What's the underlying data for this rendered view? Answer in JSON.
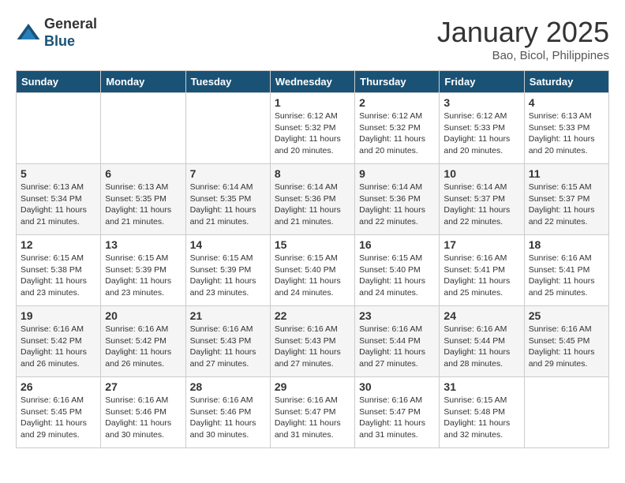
{
  "logo": {
    "general": "General",
    "blue": "Blue"
  },
  "title": "January 2025",
  "subtitle": "Bao, Bicol, Philippines",
  "days_of_week": [
    "Sunday",
    "Monday",
    "Tuesday",
    "Wednesday",
    "Thursday",
    "Friday",
    "Saturday"
  ],
  "weeks": [
    [
      {
        "day": "",
        "sunrise": "",
        "sunset": "",
        "daylight": ""
      },
      {
        "day": "",
        "sunrise": "",
        "sunset": "",
        "daylight": ""
      },
      {
        "day": "",
        "sunrise": "",
        "sunset": "",
        "daylight": ""
      },
      {
        "day": "1",
        "sunrise": "Sunrise: 6:12 AM",
        "sunset": "Sunset: 5:32 PM",
        "daylight": "Daylight: 11 hours and 20 minutes."
      },
      {
        "day": "2",
        "sunrise": "Sunrise: 6:12 AM",
        "sunset": "Sunset: 5:32 PM",
        "daylight": "Daylight: 11 hours and 20 minutes."
      },
      {
        "day": "3",
        "sunrise": "Sunrise: 6:12 AM",
        "sunset": "Sunset: 5:33 PM",
        "daylight": "Daylight: 11 hours and 20 minutes."
      },
      {
        "day": "4",
        "sunrise": "Sunrise: 6:13 AM",
        "sunset": "Sunset: 5:33 PM",
        "daylight": "Daylight: 11 hours and 20 minutes."
      }
    ],
    [
      {
        "day": "5",
        "sunrise": "Sunrise: 6:13 AM",
        "sunset": "Sunset: 5:34 PM",
        "daylight": "Daylight: 11 hours and 21 minutes."
      },
      {
        "day": "6",
        "sunrise": "Sunrise: 6:13 AM",
        "sunset": "Sunset: 5:35 PM",
        "daylight": "Daylight: 11 hours and 21 minutes."
      },
      {
        "day": "7",
        "sunrise": "Sunrise: 6:14 AM",
        "sunset": "Sunset: 5:35 PM",
        "daylight": "Daylight: 11 hours and 21 minutes."
      },
      {
        "day": "8",
        "sunrise": "Sunrise: 6:14 AM",
        "sunset": "Sunset: 5:36 PM",
        "daylight": "Daylight: 11 hours and 21 minutes."
      },
      {
        "day": "9",
        "sunrise": "Sunrise: 6:14 AM",
        "sunset": "Sunset: 5:36 PM",
        "daylight": "Daylight: 11 hours and 22 minutes."
      },
      {
        "day": "10",
        "sunrise": "Sunrise: 6:14 AM",
        "sunset": "Sunset: 5:37 PM",
        "daylight": "Daylight: 11 hours and 22 minutes."
      },
      {
        "day": "11",
        "sunrise": "Sunrise: 6:15 AM",
        "sunset": "Sunset: 5:37 PM",
        "daylight": "Daylight: 11 hours and 22 minutes."
      }
    ],
    [
      {
        "day": "12",
        "sunrise": "Sunrise: 6:15 AM",
        "sunset": "Sunset: 5:38 PM",
        "daylight": "Daylight: 11 hours and 23 minutes."
      },
      {
        "day": "13",
        "sunrise": "Sunrise: 6:15 AM",
        "sunset": "Sunset: 5:39 PM",
        "daylight": "Daylight: 11 hours and 23 minutes."
      },
      {
        "day": "14",
        "sunrise": "Sunrise: 6:15 AM",
        "sunset": "Sunset: 5:39 PM",
        "daylight": "Daylight: 11 hours and 23 minutes."
      },
      {
        "day": "15",
        "sunrise": "Sunrise: 6:15 AM",
        "sunset": "Sunset: 5:40 PM",
        "daylight": "Daylight: 11 hours and 24 minutes."
      },
      {
        "day": "16",
        "sunrise": "Sunrise: 6:15 AM",
        "sunset": "Sunset: 5:40 PM",
        "daylight": "Daylight: 11 hours and 24 minutes."
      },
      {
        "day": "17",
        "sunrise": "Sunrise: 6:16 AM",
        "sunset": "Sunset: 5:41 PM",
        "daylight": "Daylight: 11 hours and 25 minutes."
      },
      {
        "day": "18",
        "sunrise": "Sunrise: 6:16 AM",
        "sunset": "Sunset: 5:41 PM",
        "daylight": "Daylight: 11 hours and 25 minutes."
      }
    ],
    [
      {
        "day": "19",
        "sunrise": "Sunrise: 6:16 AM",
        "sunset": "Sunset: 5:42 PM",
        "daylight": "Daylight: 11 hours and 26 minutes."
      },
      {
        "day": "20",
        "sunrise": "Sunrise: 6:16 AM",
        "sunset": "Sunset: 5:42 PM",
        "daylight": "Daylight: 11 hours and 26 minutes."
      },
      {
        "day": "21",
        "sunrise": "Sunrise: 6:16 AM",
        "sunset": "Sunset: 5:43 PM",
        "daylight": "Daylight: 11 hours and 27 minutes."
      },
      {
        "day": "22",
        "sunrise": "Sunrise: 6:16 AM",
        "sunset": "Sunset: 5:43 PM",
        "daylight": "Daylight: 11 hours and 27 minutes."
      },
      {
        "day": "23",
        "sunrise": "Sunrise: 6:16 AM",
        "sunset": "Sunset: 5:44 PM",
        "daylight": "Daylight: 11 hours and 27 minutes."
      },
      {
        "day": "24",
        "sunrise": "Sunrise: 6:16 AM",
        "sunset": "Sunset: 5:44 PM",
        "daylight": "Daylight: 11 hours and 28 minutes."
      },
      {
        "day": "25",
        "sunrise": "Sunrise: 6:16 AM",
        "sunset": "Sunset: 5:45 PM",
        "daylight": "Daylight: 11 hours and 29 minutes."
      }
    ],
    [
      {
        "day": "26",
        "sunrise": "Sunrise: 6:16 AM",
        "sunset": "Sunset: 5:45 PM",
        "daylight": "Daylight: 11 hours and 29 minutes."
      },
      {
        "day": "27",
        "sunrise": "Sunrise: 6:16 AM",
        "sunset": "Sunset: 5:46 PM",
        "daylight": "Daylight: 11 hours and 30 minutes."
      },
      {
        "day": "28",
        "sunrise": "Sunrise: 6:16 AM",
        "sunset": "Sunset: 5:46 PM",
        "daylight": "Daylight: 11 hours and 30 minutes."
      },
      {
        "day": "29",
        "sunrise": "Sunrise: 6:16 AM",
        "sunset": "Sunset: 5:47 PM",
        "daylight": "Daylight: 11 hours and 31 minutes."
      },
      {
        "day": "30",
        "sunrise": "Sunrise: 6:16 AM",
        "sunset": "Sunset: 5:47 PM",
        "daylight": "Daylight: 11 hours and 31 minutes."
      },
      {
        "day": "31",
        "sunrise": "Sunrise: 6:15 AM",
        "sunset": "Sunset: 5:48 PM",
        "daylight": "Daylight: 11 hours and 32 minutes."
      },
      {
        "day": "",
        "sunrise": "",
        "sunset": "",
        "daylight": ""
      }
    ]
  ]
}
